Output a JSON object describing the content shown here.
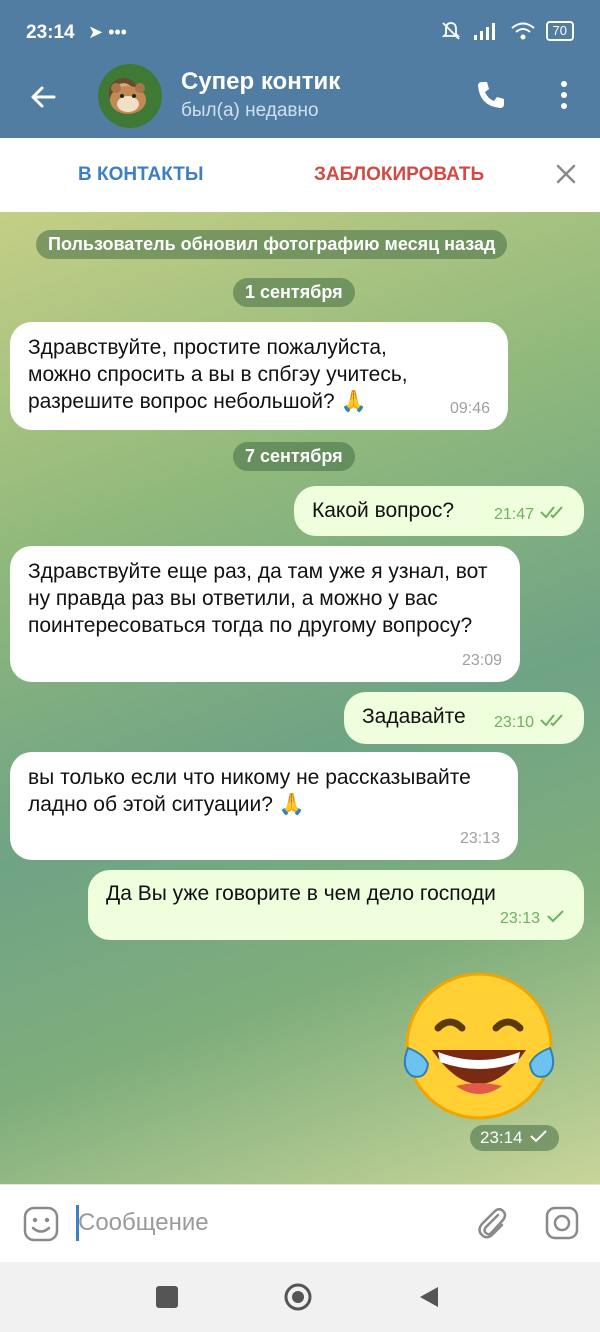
{
  "status_bar": {
    "time": "23:14",
    "extra": "➤ •••",
    "battery": "70"
  },
  "header": {
    "title": "Супер контик",
    "subtitle": "был(а) недавно"
  },
  "actions": {
    "add_contact": "В КОНТАКТЫ",
    "block": "ЗАБЛОКИРОВАТЬ"
  },
  "chat": {
    "service_message": "Пользователь обновил фотографию месяц назад",
    "date1": "1 сентября",
    "date2": "7 сентября",
    "messages": [
      {
        "text": "Здравствуйте, простите пожалуйста, можно спросить а вы в спбгэу учитесь, разрешите вопрос небольшой? 🙏",
        "time": "09:46"
      },
      {
        "text": "Какой вопрос?",
        "time": "21:47"
      },
      {
        "text": "Здравствуйте еще раз, да там уже я узнал, вот ну правда раз вы ответили, а можно у вас поинтересоваться тогда по другому вопросу?",
        "time": "23:09"
      },
      {
        "text": "Задавайте",
        "time": "23:10"
      },
      {
        "text": "вы только если что никому не рассказывайте ладно об этой ситуации? 🙏",
        "time": "23:13"
      },
      {
        "text": "Да Вы уже говорите в чем дело господи",
        "time": "23:13"
      },
      {
        "text": "",
        "time": "23:14"
      }
    ]
  },
  "input": {
    "placeholder": "Сообщение"
  },
  "colors": {
    "header": "#517da2",
    "outgoing": "#effedd",
    "incoming": "#ffffff",
    "accent": "#3c7fc2",
    "danger": "#d24a43"
  },
  "icons": [
    "back-arrow-icon",
    "phone-icon",
    "more-vertical-icon",
    "close-icon",
    "emoji-icon",
    "attach-icon",
    "camera-icon",
    "double-check-icon",
    "check-icon"
  ]
}
